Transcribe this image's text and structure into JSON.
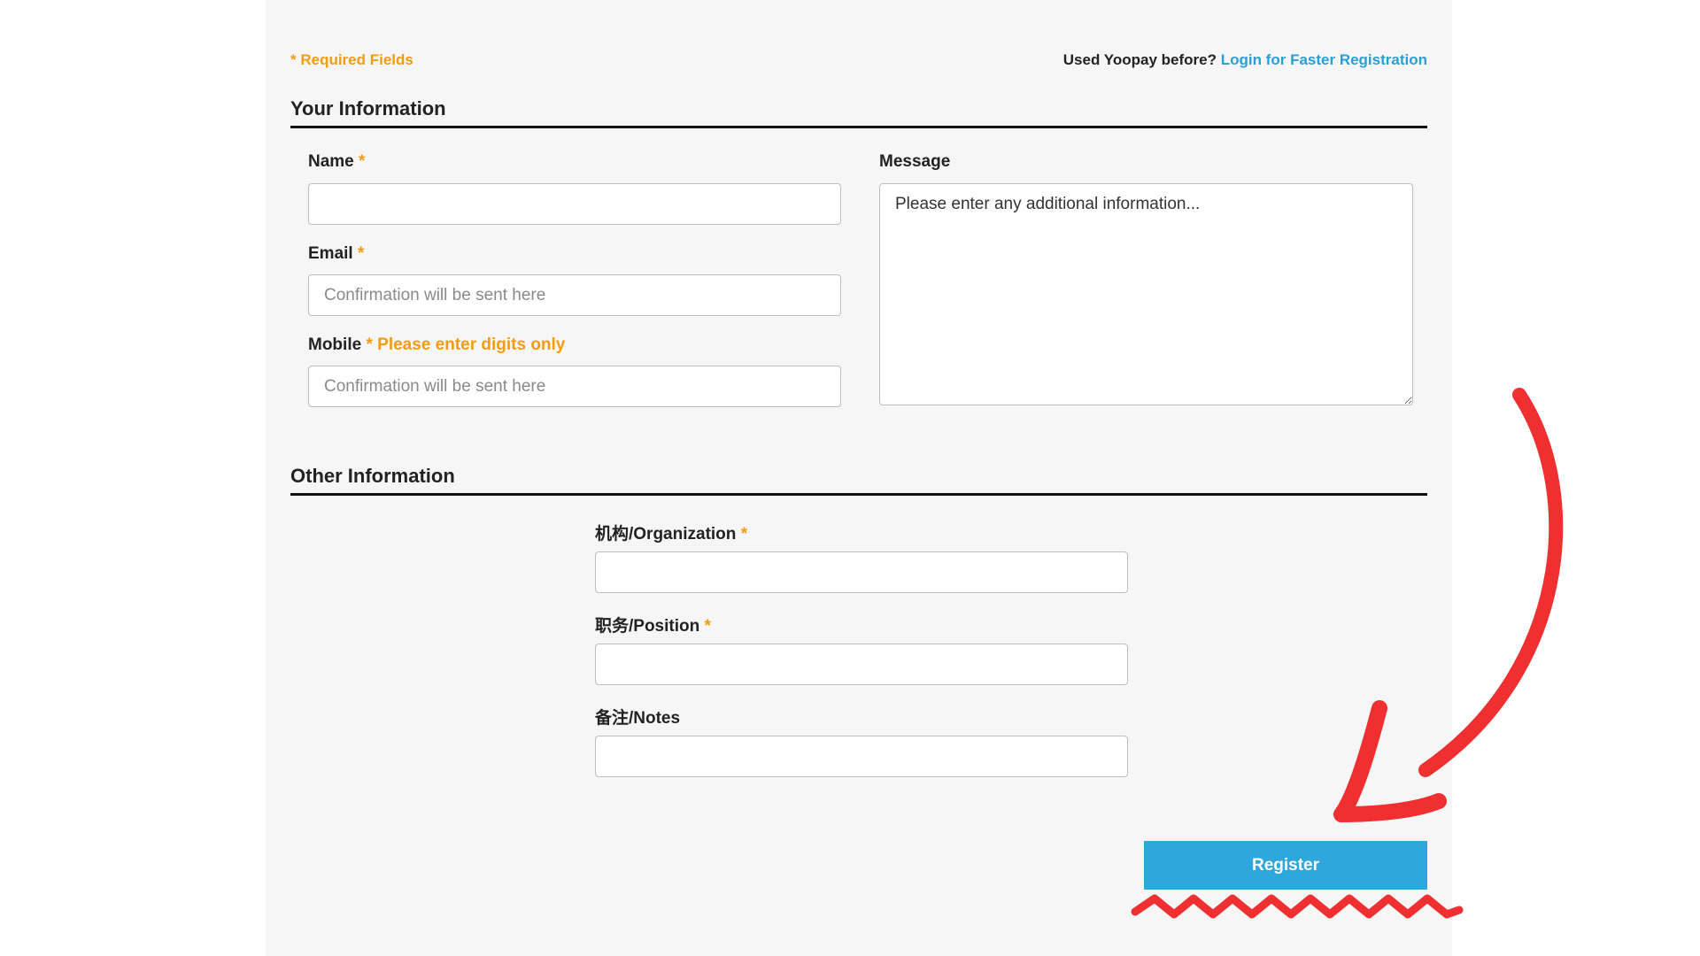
{
  "header": {
    "required_note": "* Required Fields",
    "login_prompt": "Used Yoopay before?",
    "login_link": "Login for Faster Registration"
  },
  "your_info": {
    "title": "Your Information",
    "name": {
      "label": "Name",
      "required_mark": "*",
      "value": ""
    },
    "email": {
      "label": "Email",
      "required_mark": "*",
      "placeholder": "Confirmation will be sent here"
    },
    "mobile": {
      "label": "Mobile",
      "required_mark": "*",
      "hint": "Please enter digits only",
      "placeholder": "Confirmation will be sent here"
    },
    "message": {
      "label": "Message",
      "placeholder": "Please enter any additional information..."
    }
  },
  "other_info": {
    "title": "Other Information",
    "organization": {
      "label": "机构/Organization",
      "required_mark": "*"
    },
    "position": {
      "label": "职务/Position",
      "required_mark": "*"
    },
    "notes": {
      "label": "备注/Notes"
    }
  },
  "actions": {
    "register_label": "Register"
  },
  "annotation": {
    "color": "#f03030"
  }
}
